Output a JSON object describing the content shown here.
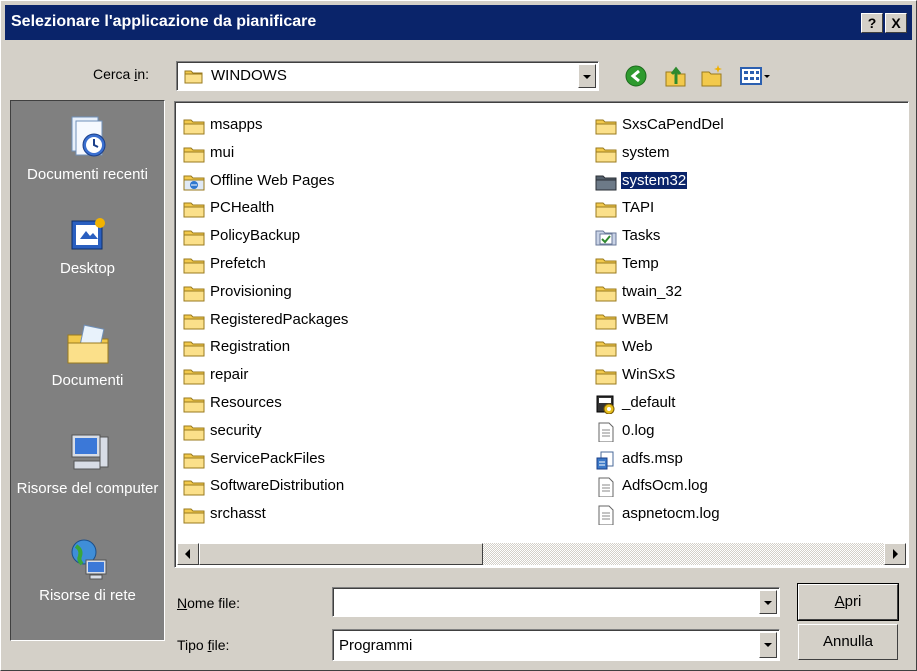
{
  "window": {
    "title": "Selezionare l'applicazione da pianificare",
    "help_btn": "?",
    "close_btn": "X"
  },
  "lookin": {
    "label_pre": "Cerca ",
    "label_key": "i",
    "label_post": "n:",
    "value": "WINDOWS"
  },
  "toolbar": {
    "back_icon": "back-icon",
    "up_icon": "up-folder-icon",
    "newfolder_icon": "new-folder-icon",
    "views_icon": "views-menu-icon"
  },
  "places": [
    {
      "label": "Documenti recenti",
      "icon": "recent-documents-icon"
    },
    {
      "label": "Desktop",
      "icon": "desktop-icon"
    },
    {
      "label": "Documenti",
      "icon": "my-documents-icon"
    },
    {
      "label": "Risorse del computer",
      "icon": "my-computer-icon"
    },
    {
      "label": "Risorse di rete",
      "icon": "network-icon"
    }
  ],
  "files": {
    "col1": [
      {
        "name": "msapps",
        "icon": "folder"
      },
      {
        "name": "mui",
        "icon": "folder"
      },
      {
        "name": "Offline Web Pages",
        "icon": "offline-pages"
      },
      {
        "name": "PCHealth",
        "icon": "folder"
      },
      {
        "name": "PolicyBackup",
        "icon": "folder"
      },
      {
        "name": "Prefetch",
        "icon": "folder"
      },
      {
        "name": "Provisioning",
        "icon": "folder"
      },
      {
        "name": "RegisteredPackages",
        "icon": "folder"
      },
      {
        "name": "Registration",
        "icon": "folder"
      },
      {
        "name": "repair",
        "icon": "folder"
      },
      {
        "name": "Resources",
        "icon": "folder"
      },
      {
        "name": "security",
        "icon": "folder"
      },
      {
        "name": "ServicePackFiles",
        "icon": "folder"
      },
      {
        "name": "SoftwareDistribution",
        "icon": "folder"
      },
      {
        "name": "srchasst",
        "icon": "folder"
      }
    ],
    "col2": [
      {
        "name": "SxsCaPendDel",
        "icon": "folder"
      },
      {
        "name": "system",
        "icon": "folder"
      },
      {
        "name": "system32",
        "icon": "folder-selected",
        "selected": true
      },
      {
        "name": "TAPI",
        "icon": "folder"
      },
      {
        "name": "Tasks",
        "icon": "tasks"
      },
      {
        "name": "Temp",
        "icon": "folder"
      },
      {
        "name": "twain_32",
        "icon": "folder"
      },
      {
        "name": "WBEM",
        "icon": "folder"
      },
      {
        "name": "Web",
        "icon": "folder"
      },
      {
        "name": "WinSxS",
        "icon": "folder"
      },
      {
        "name": "_default",
        "icon": "media"
      },
      {
        "name": "0.log",
        "icon": "text-file"
      },
      {
        "name": "adfs.msp",
        "icon": "installer"
      },
      {
        "name": "AdfsOcm.log",
        "icon": "text-file"
      },
      {
        "name": "aspnetocm.log",
        "icon": "text-file"
      }
    ]
  },
  "filename": {
    "label_key": "N",
    "label_rest": "ome file:",
    "value": ""
  },
  "filetype": {
    "label_pre": "Tipo ",
    "label_key": "f",
    "label_post": "ile:",
    "value": "Programmi"
  },
  "buttons": {
    "open_key": "A",
    "open_rest": "pri",
    "cancel": "Annulla"
  }
}
